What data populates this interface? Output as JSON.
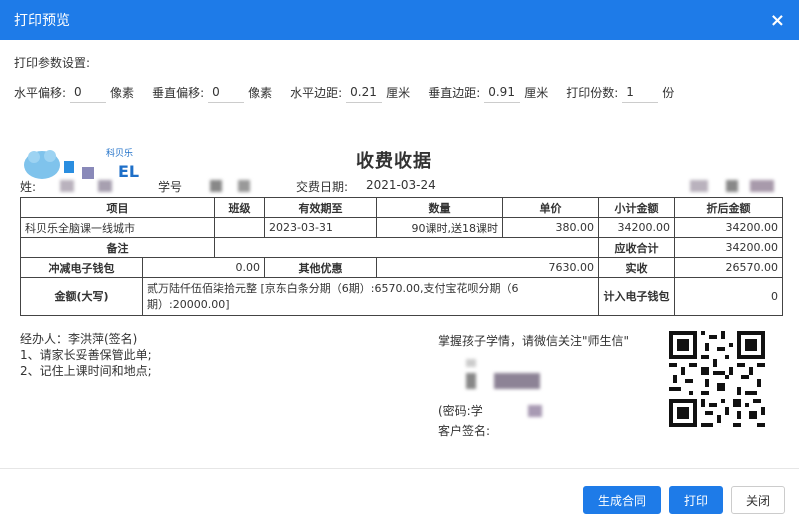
{
  "dialog": {
    "title": "打印预览",
    "close": "×"
  },
  "params": {
    "heading": "打印参数设置:",
    "h_offset": {
      "label": "水平偏移:",
      "value": "0",
      "unit": "像素"
    },
    "v_offset": {
      "label": "垂直偏移:",
      "value": "0",
      "unit": "像素"
    },
    "h_margin": {
      "label": "水平边距:",
      "value": "0.21",
      "unit": "厘米"
    },
    "v_margin": {
      "label": "垂直边距:",
      "value": "0.91",
      "unit": "厘米"
    },
    "copies": {
      "label": "打印份数:",
      "value": "1",
      "unit": "份"
    }
  },
  "receipt": {
    "logo_text": "科贝乐",
    "logo_letters": "EL",
    "title": "收费收据",
    "name_label": "姓:",
    "student_no_label": "学号",
    "pay_date_label": "交费日期:",
    "pay_date": "2021-03-24",
    "headers": {
      "item": "项目",
      "class": "班级",
      "valid_until": "有效期至",
      "qty": "数量",
      "unit_price": "单价",
      "subtotal": "小计金额",
      "discount_amount": "折后金额"
    },
    "row": {
      "item": "科贝乐全脑课一线城市",
      "class": "",
      "valid_until": "2023-03-31",
      "qty": "90课时,送18课时",
      "unit_price": "380.00",
      "subtotal": "34200.00",
      "discount_amount": "34200.00"
    },
    "remarks_label": "备注",
    "receivable_label": "应收合计",
    "receivable": "34200.00",
    "wallet_deduct_label": "冲减电子钱包",
    "wallet_deduct": "0.00",
    "other_discount_label": "其他优惠",
    "other_discount": "7630.00",
    "actual_label": "实收",
    "actual": "26570.00",
    "amount_upper_label": "金额(大写)",
    "amount_upper": "贰万陆仟伍佰柒拾元整 [京东白条分期（6期）:6570.00,支付宝花呗分期（6期）:20000.00]",
    "wallet_credit_label": "计入电子钱包",
    "wallet_credit": "0",
    "handler": "经办人：李洪萍(签名)",
    "note1": "1、请家长妥善保管此单;",
    "note2": "2、记住上课时间和地点;",
    "wechat_text": "掌握孩子学情，请微信关注\"师生信\"",
    "password_text": "(密码:学",
    "customer_sign": "客户签名:"
  },
  "buttons": {
    "contract": "生成合同",
    "print": "打印",
    "close": "关闭"
  }
}
